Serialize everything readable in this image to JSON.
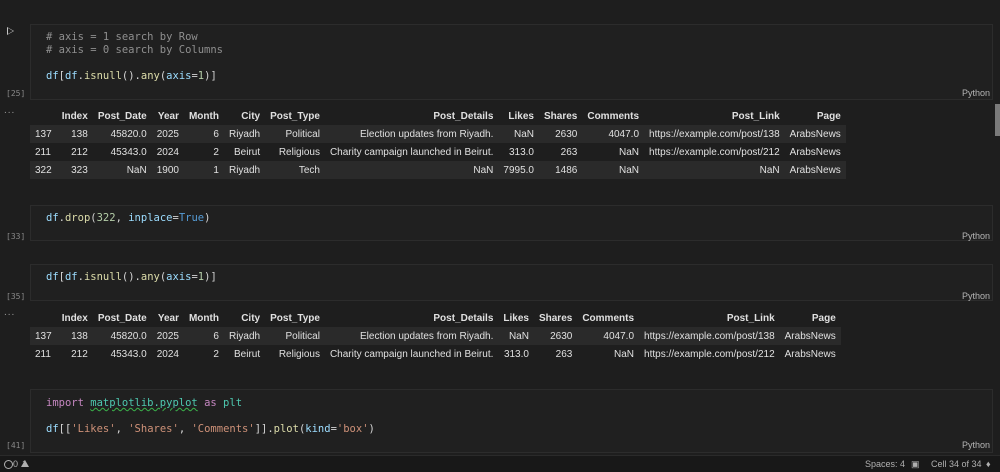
{
  "cells": [
    {
      "exec_count": "[25]",
      "lang": "Python",
      "lines": [
        "# axis = 1 search by Row",
        "# axis = 0 search by Columns",
        "",
        "df[df.isnull().any(axis=1)]"
      ],
      "output_table": {
        "headers": [
          "",
          "Index",
          "Post_Date",
          "Year",
          "Month",
          "City",
          "Post_Type",
          "Post_Details",
          "Likes",
          "Shares",
          "Comments",
          "Post_Link",
          "Page"
        ],
        "rows": [
          [
            "137",
            "138",
            "45820.0",
            "2025",
            "6",
            "Riyadh",
            "Political",
            "Election updates from Riyadh.",
            "NaN",
            "2630",
            "4047.0",
            "https://example.com/post/138",
            "ArabsNews"
          ],
          [
            "211",
            "212",
            "45343.0",
            "2024",
            "2",
            "Beirut",
            "Religious",
            "Charity campaign launched in Beirut.",
            "313.0",
            "263",
            "NaN",
            "https://example.com/post/212",
            "ArabsNews"
          ],
          [
            "322",
            "323",
            "NaN",
            "1900",
            "1",
            "Riyadh",
            "Tech",
            "NaN",
            "7995.0",
            "1486",
            "NaN",
            "NaN",
            "ArabsNews"
          ]
        ]
      }
    },
    {
      "exec_count": "[33]",
      "lang": "Python",
      "lines": [
        "df.drop(322, inplace=True)"
      ]
    },
    {
      "exec_count": "[35]",
      "lang": "Python",
      "lines": [
        "df[df.isnull().any(axis=1)]"
      ],
      "output_table": {
        "headers": [
          "",
          "Index",
          "Post_Date",
          "Year",
          "Month",
          "City",
          "Post_Type",
          "Post_Details",
          "Likes",
          "Shares",
          "Comments",
          "Post_Link",
          "Page"
        ],
        "rows": [
          [
            "137",
            "138",
            "45820.0",
            "2025",
            "6",
            "Riyadh",
            "Political",
            "Election updates from Riyadh.",
            "NaN",
            "2630",
            "4047.0",
            "https://example.com/post/138",
            "ArabsNews"
          ],
          [
            "211",
            "212",
            "45343.0",
            "2024",
            "2",
            "Beirut",
            "Religious",
            "Charity campaign launched in Beirut.",
            "313.0",
            "263",
            "NaN",
            "https://example.com/post/212",
            "ArabsNews"
          ]
        ]
      }
    },
    {
      "exec_count": "[41]",
      "lang": "Python",
      "lines": [
        "import matplotlib.pyplot as plt",
        "",
        "df[['Likes', 'Shares', 'Comments']].plot(kind='box')"
      ]
    }
  ],
  "code_tokens": {
    "c1_comment1": "# axis = 1 search by Row",
    "c1_comment2": "# axis = 0 search by Columns",
    "df": "df",
    "isnull": "isnull",
    "any": "any",
    "axis": "axis",
    "one": "1",
    "drop": "drop",
    "n322": "322",
    "inplace": "inplace",
    "true": "True",
    "import": "import",
    "module": "matplotlib.pyplot",
    "as": "as",
    "plt": "plt",
    "s_likes": "'Likes'",
    "s_shares": "'Shares'",
    "s_comments": "'Comments'",
    "plot": "plot",
    "kind": "kind",
    "s_box": "'box'"
  },
  "output_dots": "...",
  "statusbar": {
    "warnings": "0",
    "errors": "1",
    "spaces": "Spaces: 4",
    "cell_position": "Cell 34 of 34"
  }
}
